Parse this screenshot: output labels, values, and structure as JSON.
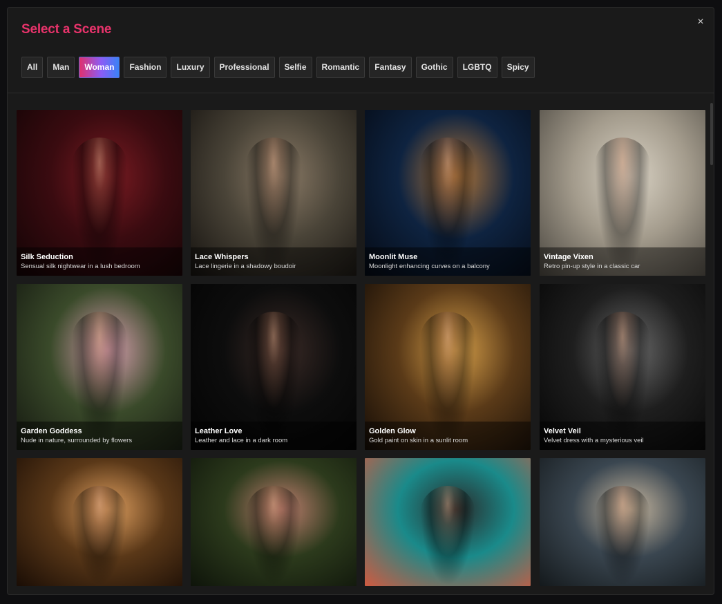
{
  "modal": {
    "title": "Select a Scene",
    "close_glyph": "×"
  },
  "filters": [
    {
      "label": "All",
      "active": false
    },
    {
      "label": "Man",
      "active": false
    },
    {
      "label": "Woman",
      "active": true
    },
    {
      "label": "Fashion",
      "active": false
    },
    {
      "label": "Luxury",
      "active": false
    },
    {
      "label": "Professional",
      "active": false
    },
    {
      "label": "Selfie",
      "active": false
    },
    {
      "label": "Romantic",
      "active": false
    },
    {
      "label": "Fantasy",
      "active": false
    },
    {
      "label": "Gothic",
      "active": false
    },
    {
      "label": "LGBTQ",
      "active": false
    },
    {
      "label": "Spicy",
      "active": false
    }
  ],
  "scenes": [
    {
      "name": "Silk Seduction",
      "description": "Sensual silk nightwear in a lush bedroom",
      "colors": [
        "#3a0b10",
        "#120405",
        "#7a1b22"
      ]
    },
    {
      "name": "Lace Whispers",
      "description": "Lace lingerie in a shadowy boudoir",
      "colors": [
        "#4a4438",
        "#15120f",
        "#8a7a66"
      ]
    },
    {
      "name": "Moonlit Muse",
      "description": "Moonlight enhancing curves on a balcony",
      "colors": [
        "#0e2340",
        "#050a14",
        "#b0763a"
      ]
    },
    {
      "name": "Vintage Vixen",
      "description": "Retro pin-up style in a classic car",
      "colors": [
        "#a39b8c",
        "#4a463f",
        "#d9d2c4"
      ]
    },
    {
      "name": "Garden Goddess",
      "description": "Nude in nature, surrounded by flowers",
      "colors": [
        "#3a4a2a",
        "#141810",
        "#d9a0b0"
      ]
    },
    {
      "name": "Leather Love",
      "description": "Leather and lace in a dark room",
      "colors": [
        "#0d0d0d",
        "#030303",
        "#3a2a26"
      ]
    },
    {
      "name": "Golden Glow",
      "description": "Gold paint on skin in a sunlit room",
      "colors": [
        "#5a3a18",
        "#140c06",
        "#d7a04a"
      ]
    },
    {
      "name": "Velvet Veil",
      "description": "Velvet dress with a mysterious veil",
      "colors": [
        "#1e1e1e",
        "#050505",
        "#6a6a6a"
      ]
    },
    {
      "name": "",
      "description": "",
      "colors": [
        "#5a3818",
        "#1a0d05",
        "#e0a060"
      ]
    },
    {
      "name": "",
      "description": "",
      "colors": [
        "#2c3a1c",
        "#0e140a",
        "#c08070"
      ]
    },
    {
      "name": "",
      "description": "",
      "colors": [
        "#1a8a8a",
        "#d05a40",
        "#2a2a2a"
      ]
    },
    {
      "name": "",
      "description": "",
      "colors": [
        "#3a4650",
        "#14191c",
        "#c8b8a0"
      ]
    }
  ]
}
